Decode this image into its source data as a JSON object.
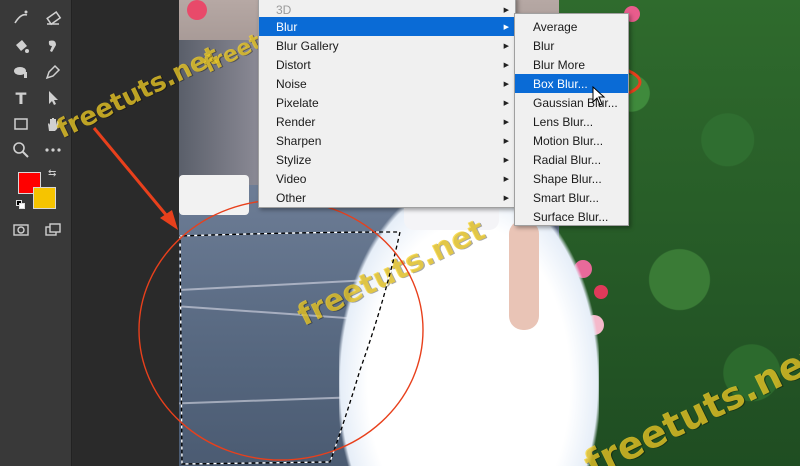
{
  "toolbar": {
    "tools": [
      {
        "icon": "lasso-sparkle-icon"
      },
      {
        "icon": "eraser-icon"
      },
      {
        "icon": "paint-bucket-icon"
      },
      {
        "icon": "smudge-icon"
      },
      {
        "icon": "dodge-icon"
      },
      {
        "icon": "pen-icon"
      },
      {
        "icon": "type-tool-icon",
        "glyph": "T"
      },
      {
        "icon": "path-select-icon"
      },
      {
        "icon": "rectangle-icon"
      },
      {
        "icon": "hand-icon"
      },
      {
        "icon": "zoom-icon"
      },
      {
        "icon": "more-icon"
      },
      {
        "icon": "quick-mask-icon"
      },
      {
        "icon": "screen-mode-icon"
      }
    ],
    "foreground_color": "#ff0000",
    "background_color": "#f6c400"
  },
  "filter_menu": {
    "items": [
      {
        "label": "3D",
        "has_submenu": true,
        "state": "partial"
      },
      {
        "label": "Blur",
        "has_submenu": true,
        "state": "highlighted"
      },
      {
        "label": "Blur Gallery",
        "has_submenu": true
      },
      {
        "label": "Distort",
        "has_submenu": true
      },
      {
        "label": "Noise",
        "has_submenu": true
      },
      {
        "label": "Pixelate",
        "has_submenu": true
      },
      {
        "label": "Render",
        "has_submenu": true
      },
      {
        "label": "Sharpen",
        "has_submenu": true
      },
      {
        "label": "Stylize",
        "has_submenu": true
      },
      {
        "label": "Video",
        "has_submenu": true
      },
      {
        "label": "Other",
        "has_submenu": true
      }
    ]
  },
  "blur_submenu": {
    "items": [
      {
        "label": "Average"
      },
      {
        "label": "Blur"
      },
      {
        "label": "Blur More"
      },
      {
        "label": "Box Blur...",
        "state": "highlighted"
      },
      {
        "label": "Gaussian Blur..."
      },
      {
        "label": "Lens Blur..."
      },
      {
        "label": "Motion Blur..."
      },
      {
        "label": "Radial Blur..."
      },
      {
        "label": "Shape Blur..."
      },
      {
        "label": "Smart Blur..."
      },
      {
        "label": "Surface Blur..."
      }
    ]
  },
  "watermark": {
    "text": "freetuts.net",
    "color": "#f5d228"
  },
  "annotation": {
    "arrow_color": "#e8401c",
    "circle_color": "#e8401c"
  }
}
